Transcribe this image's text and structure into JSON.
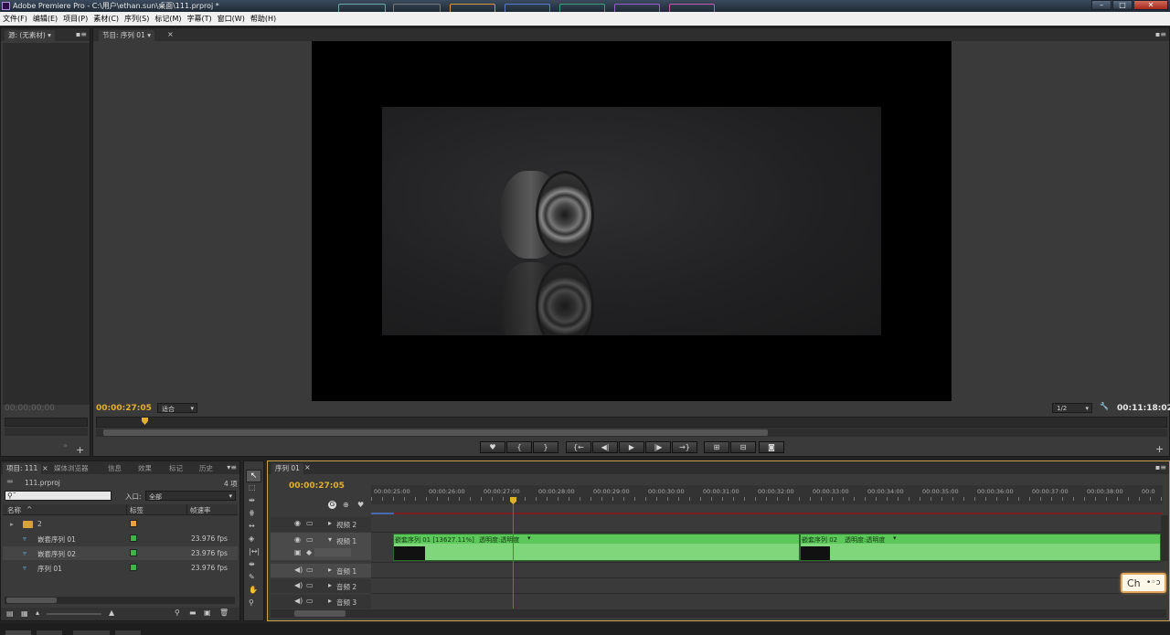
{
  "window": {
    "title": "Adobe Premiere Pro - C:\\用户\\ethan.sun\\桌面\\111.prproj *",
    "min_label": "–",
    "max_label": "□",
    "close_label": "✕"
  },
  "menu": [
    "文件(F)",
    "编辑(E)",
    "项目(P)",
    "素材(C)",
    "序列(S)",
    "标记(M)",
    "字幕(T)",
    "窗口(W)",
    "帮助(H)"
  ],
  "source_monitor": {
    "tab": "源: (无素材)",
    "timecode": "00;00;00;00"
  },
  "program_monitor": {
    "tab": "节目: 序列 01",
    "timecode": "00:00:27:05",
    "fit": "适合",
    "resolution": "1/2",
    "duration": "00:11:18:02"
  },
  "project": {
    "tabs": [
      "项目: 111",
      "媒体浏览器",
      "信息",
      "效果",
      "标记",
      "历史"
    ],
    "file": "111.prproj",
    "count": "4 项",
    "search_placeholder": "",
    "in_label": "入口:",
    "in_value": "全部",
    "headers": {
      "name": "名称",
      "label": "标签",
      "fps": "帧速率"
    },
    "items": [
      {
        "name": "2",
        "type": "folder",
        "label_color": "#e8a23a",
        "fps": ""
      },
      {
        "name": "嵌套序列 01",
        "type": "sequence",
        "label_color": "#3db34a",
        "fps": "23.976 fps"
      },
      {
        "name": "嵌套序列 02",
        "type": "sequence",
        "label_color": "#3db34a",
        "fps": "23.976 fps"
      },
      {
        "name": "序列 01",
        "type": "sequence",
        "label_color": "#3db34a",
        "fps": "23.976 fps"
      }
    ]
  },
  "timeline": {
    "tab": "序列 01",
    "timecode": "00:00:27:05",
    "ruler": [
      "00:00:25:00",
      "00:00:26:00",
      "00:00:27:00",
      "00:00:28:00",
      "00:00:29:00",
      "00:00:30:00",
      "00:00:31:00",
      "00:00:32:00",
      "00:00:33:00",
      "00:00:34:00",
      "00:00:35:00",
      "00:00:36:00",
      "00:00:37:00",
      "00:00:38:00",
      "00:0"
    ],
    "tracks": {
      "v2": "视频 2",
      "v1": "视频 1",
      "a1": "音频 1",
      "a2": "音频 2",
      "a3": "音频 3"
    },
    "clip1": {
      "name": "嵌套序列 01 [13627.11%]",
      "effect": "透明度:透明度"
    },
    "clip2": {
      "name": "嵌套序列 02",
      "effect": "透明度:透明度"
    }
  },
  "ime": {
    "label": "Ch"
  },
  "colors": {
    "accent_timecode": "#e3b02c",
    "clip_green": "#6fd36c",
    "clip_header": "#5cc85a",
    "playhead": "#d04a2a"
  }
}
